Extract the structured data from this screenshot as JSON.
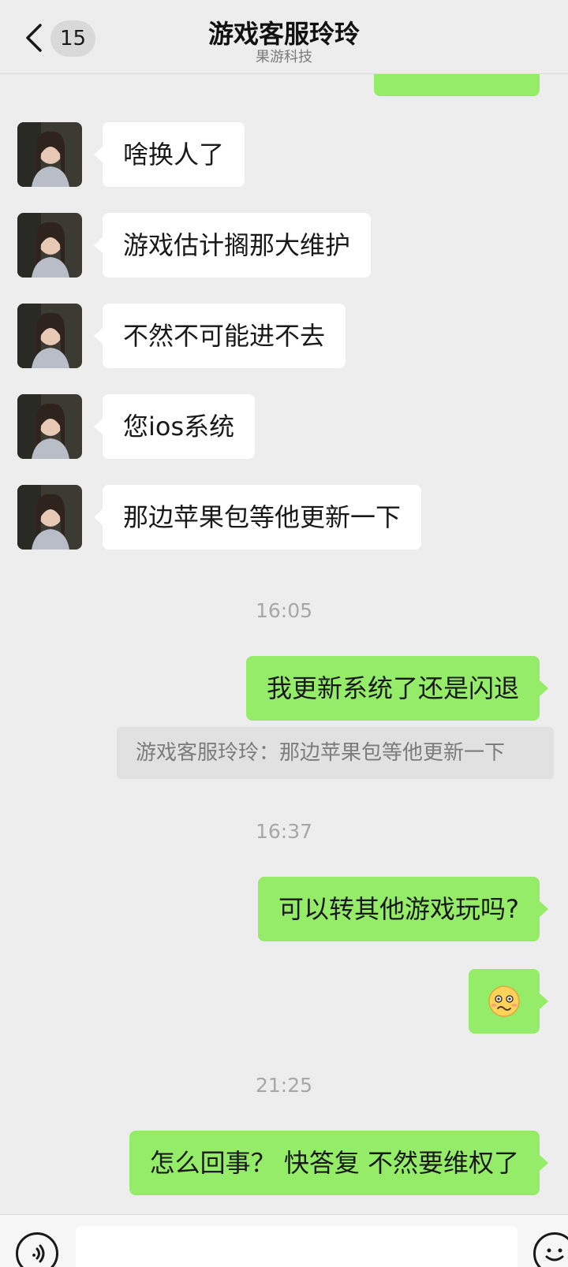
{
  "header": {
    "unread_count": "15",
    "title": "游戏客服玲玲",
    "subtitle": "果游科技"
  },
  "messages": {
    "in_1": "啥换人了",
    "in_2": "游戏估计搁那大维护",
    "in_3": "不然不可能进不去",
    "in_4": "您ios系统",
    "in_5": "那边苹果包等他更新一下",
    "time_1": "16:05",
    "out_1": "我更新系统了还是闪退",
    "quote_1": "游戏客服玲玲：那边苹果包等他更新一下",
    "time_2": "16:37",
    "out_2": "可以转其他游戏玩吗?",
    "time_3": "21:25",
    "out_4": "怎么回事？ 快答复 不然要维权了"
  },
  "emoji": {
    "name": "woozy-face-emoji"
  },
  "colors": {
    "outgoing_bubble": "#95ec69",
    "incoming_bubble": "#ffffff",
    "background": "#ededed"
  }
}
